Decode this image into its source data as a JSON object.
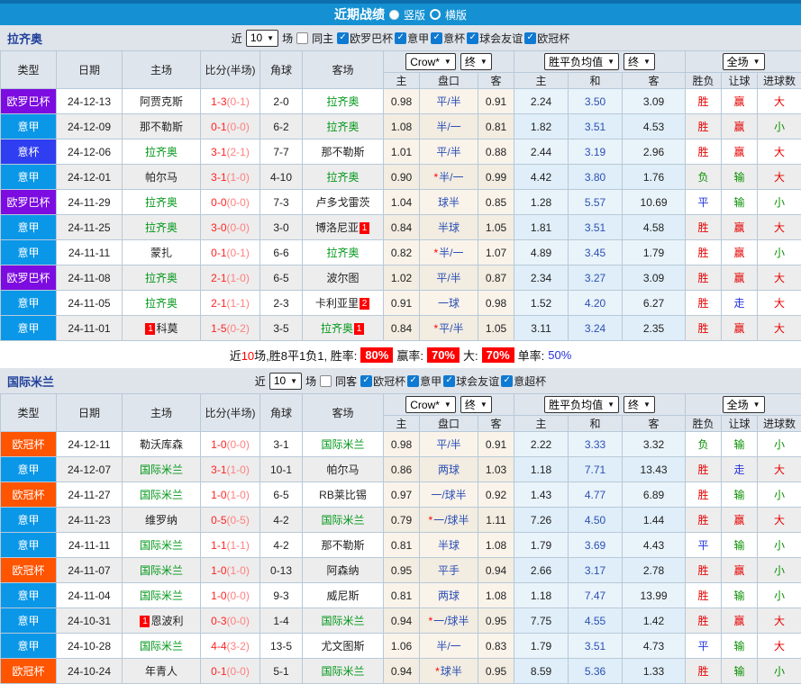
{
  "titlebar": {
    "title": "近期战绩",
    "vertical_label": "竖版",
    "horizontal_label": "横版"
  },
  "table_header": {
    "type": "类型",
    "date": "日期",
    "home": "主场",
    "score": "比分(半场)",
    "corners": "角球",
    "away": "客场",
    "odds_select": "Crow*",
    "final_select": "终",
    "avg_select": "胜平负均值",
    "period_select": "全场",
    "odds_home": "主",
    "odds_handicap": "盘口",
    "odds_away": "客",
    "avg_home": "主",
    "avg_draw": "和",
    "avg_away": "客",
    "result": "胜负",
    "let_goal": "让球",
    "goals": "进球数"
  },
  "league_colors": {
    "欧罗巴杯": "#7c0ce0",
    "意甲": "#0a97e8",
    "意杯": "#2e3ef0",
    "欧冠杯": "#ff5400"
  },
  "sections": [
    {
      "team": "拉齐奥",
      "filter": {
        "near": "近",
        "count": "10",
        "games": "场",
        "same": "同主",
        "leagues": [
          "欧罗巴杯",
          "意甲",
          "意杯",
          "球会友谊",
          "欧冠杯"
        ]
      },
      "rows": [
        {
          "league": "欧罗巴杯",
          "date": "24-12-13",
          "home": {
            "name": "阿贾克斯"
          },
          "ft": "1-3",
          "ht": "(0-1)",
          "corners": "2-0",
          "away": {
            "name": "拉齐奥",
            "focal": true
          },
          "o1": "0.98",
          "hc": "平/半",
          "o2": "0.91",
          "a1": "2.24",
          "a2": "3.50",
          "a3": "3.09",
          "r": [
            "胜",
            "red"
          ],
          "l": [
            "赢",
            "red"
          ],
          "g": [
            "大",
            "red"
          ]
        },
        {
          "league": "意甲",
          "date": "24-12-09",
          "home": {
            "name": "那不勒斯"
          },
          "ft": "0-1",
          "ht": "(0-0)",
          "corners": "6-2",
          "away": {
            "name": "拉齐奥",
            "focal": true
          },
          "o1": "1.08",
          "hc": "半/一",
          "o2": "0.81",
          "a1": "1.82",
          "a2": "3.51",
          "a3": "4.53",
          "r": [
            "胜",
            "red"
          ],
          "l": [
            "赢",
            "red"
          ],
          "g": [
            "小",
            "green"
          ]
        },
        {
          "league": "意杯",
          "date": "24-12-06",
          "home": {
            "name": "拉齐奥",
            "focal": true
          },
          "ft": "3-1",
          "ht": "(2-1)",
          "corners": "7-7",
          "away": {
            "name": "那不勒斯"
          },
          "o1": "1.01",
          "hc": "平/半",
          "o2": "0.88",
          "a1": "2.44",
          "a2": "3.19",
          "a3": "2.96",
          "r": [
            "胜",
            "red"
          ],
          "l": [
            "赢",
            "red"
          ],
          "g": [
            "大",
            "red"
          ]
        },
        {
          "league": "意甲",
          "date": "24-12-01",
          "home": {
            "name": "帕尔马"
          },
          "ft": "3-1",
          "ht": "(1-0)",
          "corners": "4-10",
          "away": {
            "name": "拉齐奥",
            "focal": true
          },
          "o1": "0.90",
          "hc": "半/一",
          "star": true,
          "o2": "0.99",
          "a1": "4.42",
          "a2": "3.80",
          "a3": "1.76",
          "r": [
            "负",
            "green"
          ],
          "l": [
            "输",
            "green"
          ],
          "g": [
            "大",
            "red"
          ]
        },
        {
          "league": "欧罗巴杯",
          "date": "24-11-29",
          "home": {
            "name": "拉齐奥",
            "focal": true
          },
          "ft": "0-0",
          "ht": "(0-0)",
          "corners": "7-3",
          "away": {
            "name": "卢多戈雷茨"
          },
          "o1": "1.04",
          "hc": "球半",
          "o2": "0.85",
          "a1": "1.28",
          "a2": "5.57",
          "a3": "10.69",
          "r": [
            "平",
            "blue"
          ],
          "l": [
            "输",
            "green"
          ],
          "g": [
            "小",
            "green"
          ]
        },
        {
          "league": "意甲",
          "date": "24-11-25",
          "home": {
            "name": "拉齐奥",
            "focal": true
          },
          "ft": "3-0",
          "ht": "(0-0)",
          "corners": "3-0",
          "away": {
            "name": "博洛尼亚",
            "badge_after": "1"
          },
          "o1": "0.84",
          "hc": "半球",
          "o2": "1.05",
          "a1": "1.81",
          "a2": "3.51",
          "a3": "4.58",
          "r": [
            "胜",
            "red"
          ],
          "l": [
            "赢",
            "red"
          ],
          "g": [
            "大",
            "red"
          ]
        },
        {
          "league": "意甲",
          "date": "24-11-11",
          "home": {
            "name": "蒙扎"
          },
          "ft": "0-1",
          "ht": "(0-1)",
          "corners": "6-6",
          "away": {
            "name": "拉齐奥",
            "focal": true
          },
          "o1": "0.82",
          "hc": "半/一",
          "star": true,
          "o2": "1.07",
          "a1": "4.89",
          "a2": "3.45",
          "a3": "1.79",
          "r": [
            "胜",
            "red"
          ],
          "l": [
            "赢",
            "red"
          ],
          "g": [
            "小",
            "green"
          ]
        },
        {
          "league": "欧罗巴杯",
          "date": "24-11-08",
          "home": {
            "name": "拉齐奥",
            "focal": true
          },
          "ft": "2-1",
          "ht": "(1-0)",
          "corners": "6-5",
          "away": {
            "name": "波尔图"
          },
          "o1": "1.02",
          "hc": "平/半",
          "o2": "0.87",
          "a1": "2.34",
          "a2": "3.27",
          "a3": "3.09",
          "r": [
            "胜",
            "red"
          ],
          "l": [
            "赢",
            "red"
          ],
          "g": [
            "大",
            "red"
          ]
        },
        {
          "league": "意甲",
          "date": "24-11-05",
          "home": {
            "name": "拉齐奥",
            "focal": true
          },
          "ft": "2-1",
          "ht": "(1-1)",
          "corners": "2-3",
          "away": {
            "name": "卡利亚里",
            "badge_after": "2"
          },
          "o1": "0.91",
          "hc": "一球",
          "o2": "0.98",
          "a1": "1.52",
          "a2": "4.20",
          "a3": "6.27",
          "r": [
            "胜",
            "red"
          ],
          "l": [
            "走",
            "blue"
          ],
          "g": [
            "大",
            "red"
          ]
        },
        {
          "league": "意甲",
          "date": "24-11-01",
          "home": {
            "name": "科莫",
            "badge_before": "1"
          },
          "ft": "1-5",
          "ht": "(0-2)",
          "corners": "3-5",
          "away": {
            "name": "拉齐奥",
            "focal": true,
            "badge_after": "1"
          },
          "o1": "0.84",
          "hc": "平/半",
          "star": true,
          "o2": "1.05",
          "a1": "3.11",
          "a2": "3.24",
          "a3": "2.35",
          "r": [
            "胜",
            "red"
          ],
          "l": [
            "赢",
            "red"
          ],
          "g": [
            "大",
            "red"
          ]
        }
      ],
      "summary": {
        "near": "近",
        "count": "10",
        "stats": "场,胜8平1负1, 胜率:",
        "win_rate": "80%",
        "let_label": "赢率:",
        "let_rate": "70%",
        "big_label": "大:",
        "big_rate": "70%",
        "single_label": "单率:",
        "single_rate": "50%"
      }
    },
    {
      "team": "国际米兰",
      "filter": {
        "near": "近",
        "count": "10",
        "games": "场",
        "same": "同客",
        "leagues": [
          "欧冠杯",
          "意甲",
          "球会友谊",
          "意超杯"
        ]
      },
      "rows": [
        {
          "league": "欧冠杯",
          "date": "24-12-11",
          "home": {
            "name": "勒沃库森"
          },
          "ft": "1-0",
          "ht": "(0-0)",
          "corners": "3-1",
          "away": {
            "name": "国际米兰",
            "focal": true
          },
          "o1": "0.98",
          "hc": "平/半",
          "o2": "0.91",
          "a1": "2.22",
          "a2": "3.33",
          "a3": "3.32",
          "r": [
            "负",
            "green"
          ],
          "l": [
            "输",
            "green"
          ],
          "g": [
            "小",
            "green"
          ]
        },
        {
          "league": "意甲",
          "date": "24-12-07",
          "home": {
            "name": "国际米兰",
            "focal": true
          },
          "ft": "3-1",
          "ht": "(1-0)",
          "corners": "10-1",
          "away": {
            "name": "帕尔马"
          },
          "o1": "0.86",
          "hc": "两球",
          "o2": "1.03",
          "a1": "1.18",
          "a2": "7.71",
          "a3": "13.43",
          "r": [
            "胜",
            "red"
          ],
          "l": [
            "走",
            "blue"
          ],
          "g": [
            "大",
            "red"
          ]
        },
        {
          "league": "欧冠杯",
          "date": "24-11-27",
          "home": {
            "name": "国际米兰",
            "focal": true
          },
          "ft": "1-0",
          "ht": "(1-0)",
          "corners": "6-5",
          "away": {
            "name": "RB莱比锡"
          },
          "o1": "0.97",
          "hc": "一/球半",
          "o2": "0.92",
          "a1": "1.43",
          "a2": "4.77",
          "a3": "6.89",
          "r": [
            "胜",
            "red"
          ],
          "l": [
            "输",
            "green"
          ],
          "g": [
            "小",
            "green"
          ]
        },
        {
          "league": "意甲",
          "date": "24-11-23",
          "home": {
            "name": "维罗纳"
          },
          "ft": "0-5",
          "ht": "(0-5)",
          "corners": "4-2",
          "away": {
            "name": "国际米兰",
            "focal": true
          },
          "o1": "0.79",
          "hc": "一/球半",
          "star": true,
          "o2": "1.11",
          "a1": "7.26",
          "a2": "4.50",
          "a3": "1.44",
          "r": [
            "胜",
            "red"
          ],
          "l": [
            "赢",
            "red"
          ],
          "g": [
            "大",
            "red"
          ]
        },
        {
          "league": "意甲",
          "date": "24-11-11",
          "home": {
            "name": "国际米兰",
            "focal": true
          },
          "ft": "1-1",
          "ht": "(1-1)",
          "corners": "4-2",
          "away": {
            "name": "那不勒斯"
          },
          "o1": "0.81",
          "hc": "半球",
          "o2": "1.08",
          "a1": "1.79",
          "a2": "3.69",
          "a3": "4.43",
          "r": [
            "平",
            "blue"
          ],
          "l": [
            "输",
            "green"
          ],
          "g": [
            "小",
            "green"
          ]
        },
        {
          "league": "欧冠杯",
          "date": "24-11-07",
          "home": {
            "name": "国际米兰",
            "focal": true
          },
          "ft": "1-0",
          "ht": "(1-0)",
          "corners": "0-13",
          "away": {
            "name": "阿森纳"
          },
          "o1": "0.95",
          "hc": "平手",
          "o2": "0.94",
          "a1": "2.66",
          "a2": "3.17",
          "a3": "2.78",
          "r": [
            "胜",
            "red"
          ],
          "l": [
            "赢",
            "red"
          ],
          "g": [
            "小",
            "green"
          ]
        },
        {
          "league": "意甲",
          "date": "24-11-04",
          "home": {
            "name": "国际米兰",
            "focal": true
          },
          "ft": "1-0",
          "ht": "(0-0)",
          "corners": "9-3",
          "away": {
            "name": "威尼斯"
          },
          "o1": "0.81",
          "hc": "两球",
          "o2": "1.08",
          "a1": "1.18",
          "a2": "7.47",
          "a3": "13.99",
          "r": [
            "胜",
            "red"
          ],
          "l": [
            "输",
            "green"
          ],
          "g": [
            "小",
            "green"
          ]
        },
        {
          "league": "意甲",
          "date": "24-10-31",
          "home": {
            "name": "恩波利",
            "badge_before": "1"
          },
          "ft": "0-3",
          "ht": "(0-0)",
          "corners": "1-4",
          "away": {
            "name": "国际米兰",
            "focal": true
          },
          "o1": "0.94",
          "hc": "一/球半",
          "star": true,
          "o2": "0.95",
          "a1": "7.75",
          "a2": "4.55",
          "a3": "1.42",
          "r": [
            "胜",
            "red"
          ],
          "l": [
            "赢",
            "red"
          ],
          "g": [
            "大",
            "red"
          ]
        },
        {
          "league": "意甲",
          "date": "24-10-28",
          "home": {
            "name": "国际米兰",
            "focal": true
          },
          "ft": "4-4",
          "ht": "(3-2)",
          "corners": "13-5",
          "away": {
            "name": "尤文图斯"
          },
          "o1": "1.06",
          "hc": "半/一",
          "o2": "0.83",
          "a1": "1.79",
          "a2": "3.51",
          "a3": "4.73",
          "r": [
            "平",
            "blue"
          ],
          "l": [
            "输",
            "green"
          ],
          "g": [
            "大",
            "red"
          ]
        },
        {
          "league": "欧冠杯",
          "date": "24-10-24",
          "home": {
            "name": "年青人"
          },
          "ft": "0-1",
          "ht": "(0-0)",
          "corners": "5-1",
          "away": {
            "name": "国际米兰",
            "focal": true
          },
          "o1": "0.94",
          "hc": "球半",
          "star": true,
          "o2": "0.95",
          "a1": "8.59",
          "a2": "5.36",
          "a3": "1.33",
          "r": [
            "胜",
            "red"
          ],
          "l": [
            "输",
            "green"
          ],
          "g": [
            "小",
            "green"
          ]
        }
      ],
      "summary": null
    }
  ]
}
